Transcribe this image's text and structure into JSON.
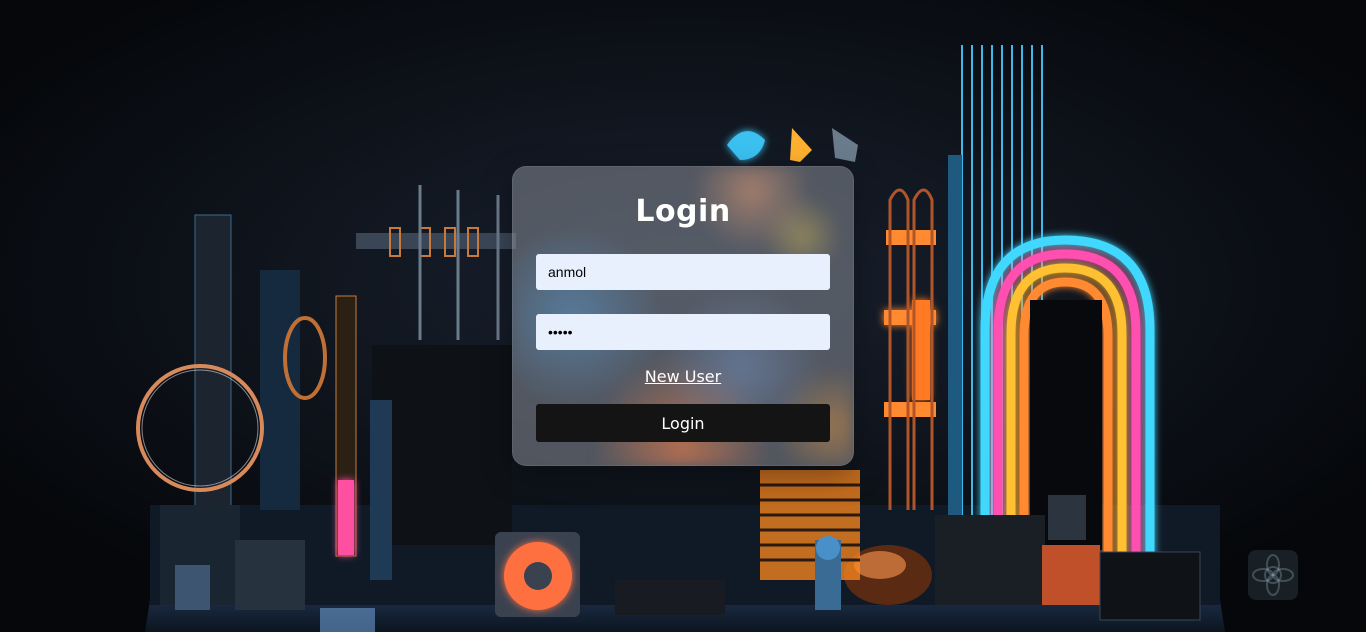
{
  "login": {
    "title": "Login",
    "username_value": "anmol",
    "password_value": "•••••",
    "new_user_link": "New User",
    "submit_label": "Login"
  },
  "colors": {
    "card_bg": "#878c96",
    "input_bg": "#e8f0fe",
    "button_bg": "#141414",
    "text_light": "#ffffff"
  },
  "icons": {
    "corner_badge": "flower-logo-icon"
  }
}
